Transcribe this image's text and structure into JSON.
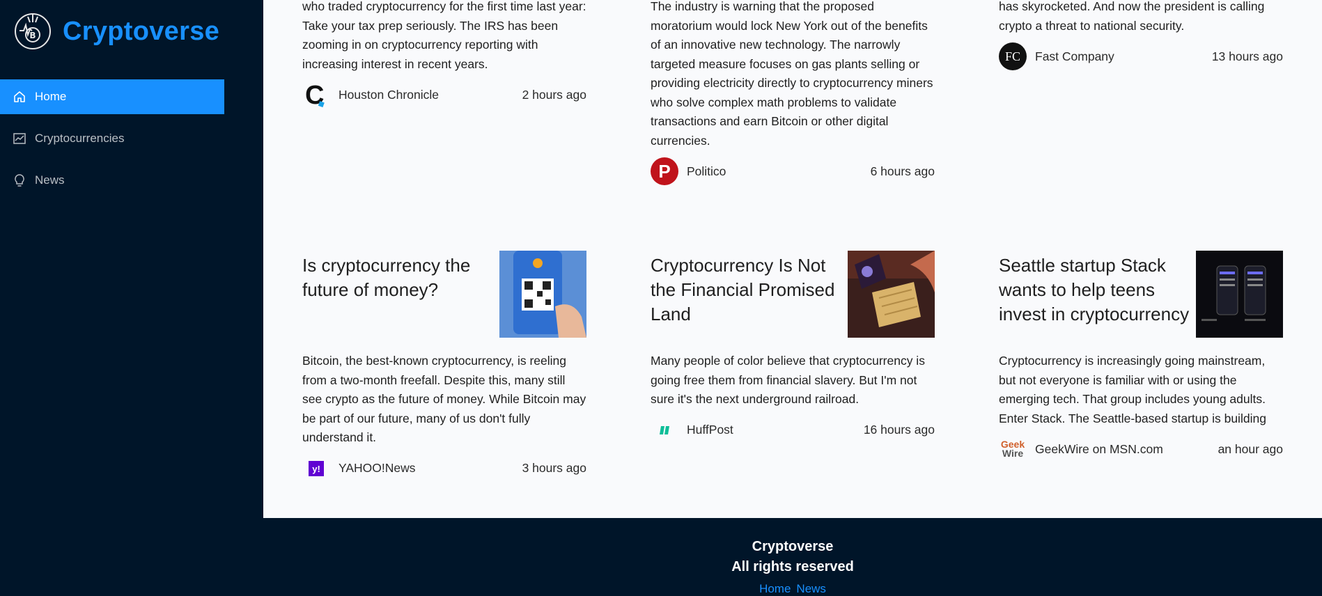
{
  "app": {
    "name": "Cryptoverse"
  },
  "sidebar": {
    "items": [
      {
        "label": "Home",
        "icon": "home-icon",
        "active": true
      },
      {
        "label": "Cryptocurrencies",
        "icon": "chart-icon",
        "active": false
      },
      {
        "label": "News",
        "icon": "bulb-icon",
        "active": false
      }
    ]
  },
  "news": {
    "row1": [
      {
        "desc": "who traded cryptocurrency for the first time last year: Take your tax prep seriously. The IRS has been zooming in on cryptocurrency reporting with increasing interest in recent years.",
        "provider": "Houston Chronicle",
        "time": "2 hours ago"
      },
      {
        "desc": "The industry is warning that the proposed moratorium would lock New York out of the benefits of an innovative new technology. The narrowly targeted measure focuses on gas plants selling or providing electricity directly to cryptocurrency miners who solve complex math problems to validate transactions and earn Bitcoin or other digital currencies.",
        "provider": "Politico",
        "time": "6 hours ago"
      },
      {
        "desc": "has skyrocketed. And now the president is calling crypto a threat to national security.",
        "provider": "Fast Company",
        "provider_logo_text": "FC",
        "time": "13 hours ago"
      }
    ],
    "row2": [
      {
        "title": "Is cryptocurrency the future of money?",
        "desc": "Bitcoin, the best-known cryptocurrency, is reeling from a two-month freefall. Despite this, many still see crypto as the future of money. While Bitcoin may be part of our future, many of us don't fully understand it.",
        "provider": "YAHOO!News",
        "time": "3 hours ago"
      },
      {
        "title": "Cryptocurrency Is Not the Financial Promised Land",
        "desc": "Many people of color believe that cryptocurrency is going free them from financial slavery. But I'm not sure it's the next underground railroad.",
        "provider": "HuffPost",
        "time": "16 hours ago"
      },
      {
        "title": "Seattle startup Stack wants to help teens invest in cryptocurrency",
        "desc": "Cryptocurrency is increasingly going mainstream, but not everyone is familiar with or using the emerging tech. That group includes young adults. Enter Stack. The Seattle-based startup is building",
        "provider": "GeekWire on MSN.com",
        "time": "an hour ago"
      }
    ]
  },
  "footer": {
    "brand": "Cryptoverse",
    "rights": "All rights reserved",
    "links": [
      "Home",
      "News"
    ]
  },
  "colors": {
    "accent": "#1890ff",
    "dark": "#001529",
    "content_bg": "#f9fafc"
  }
}
